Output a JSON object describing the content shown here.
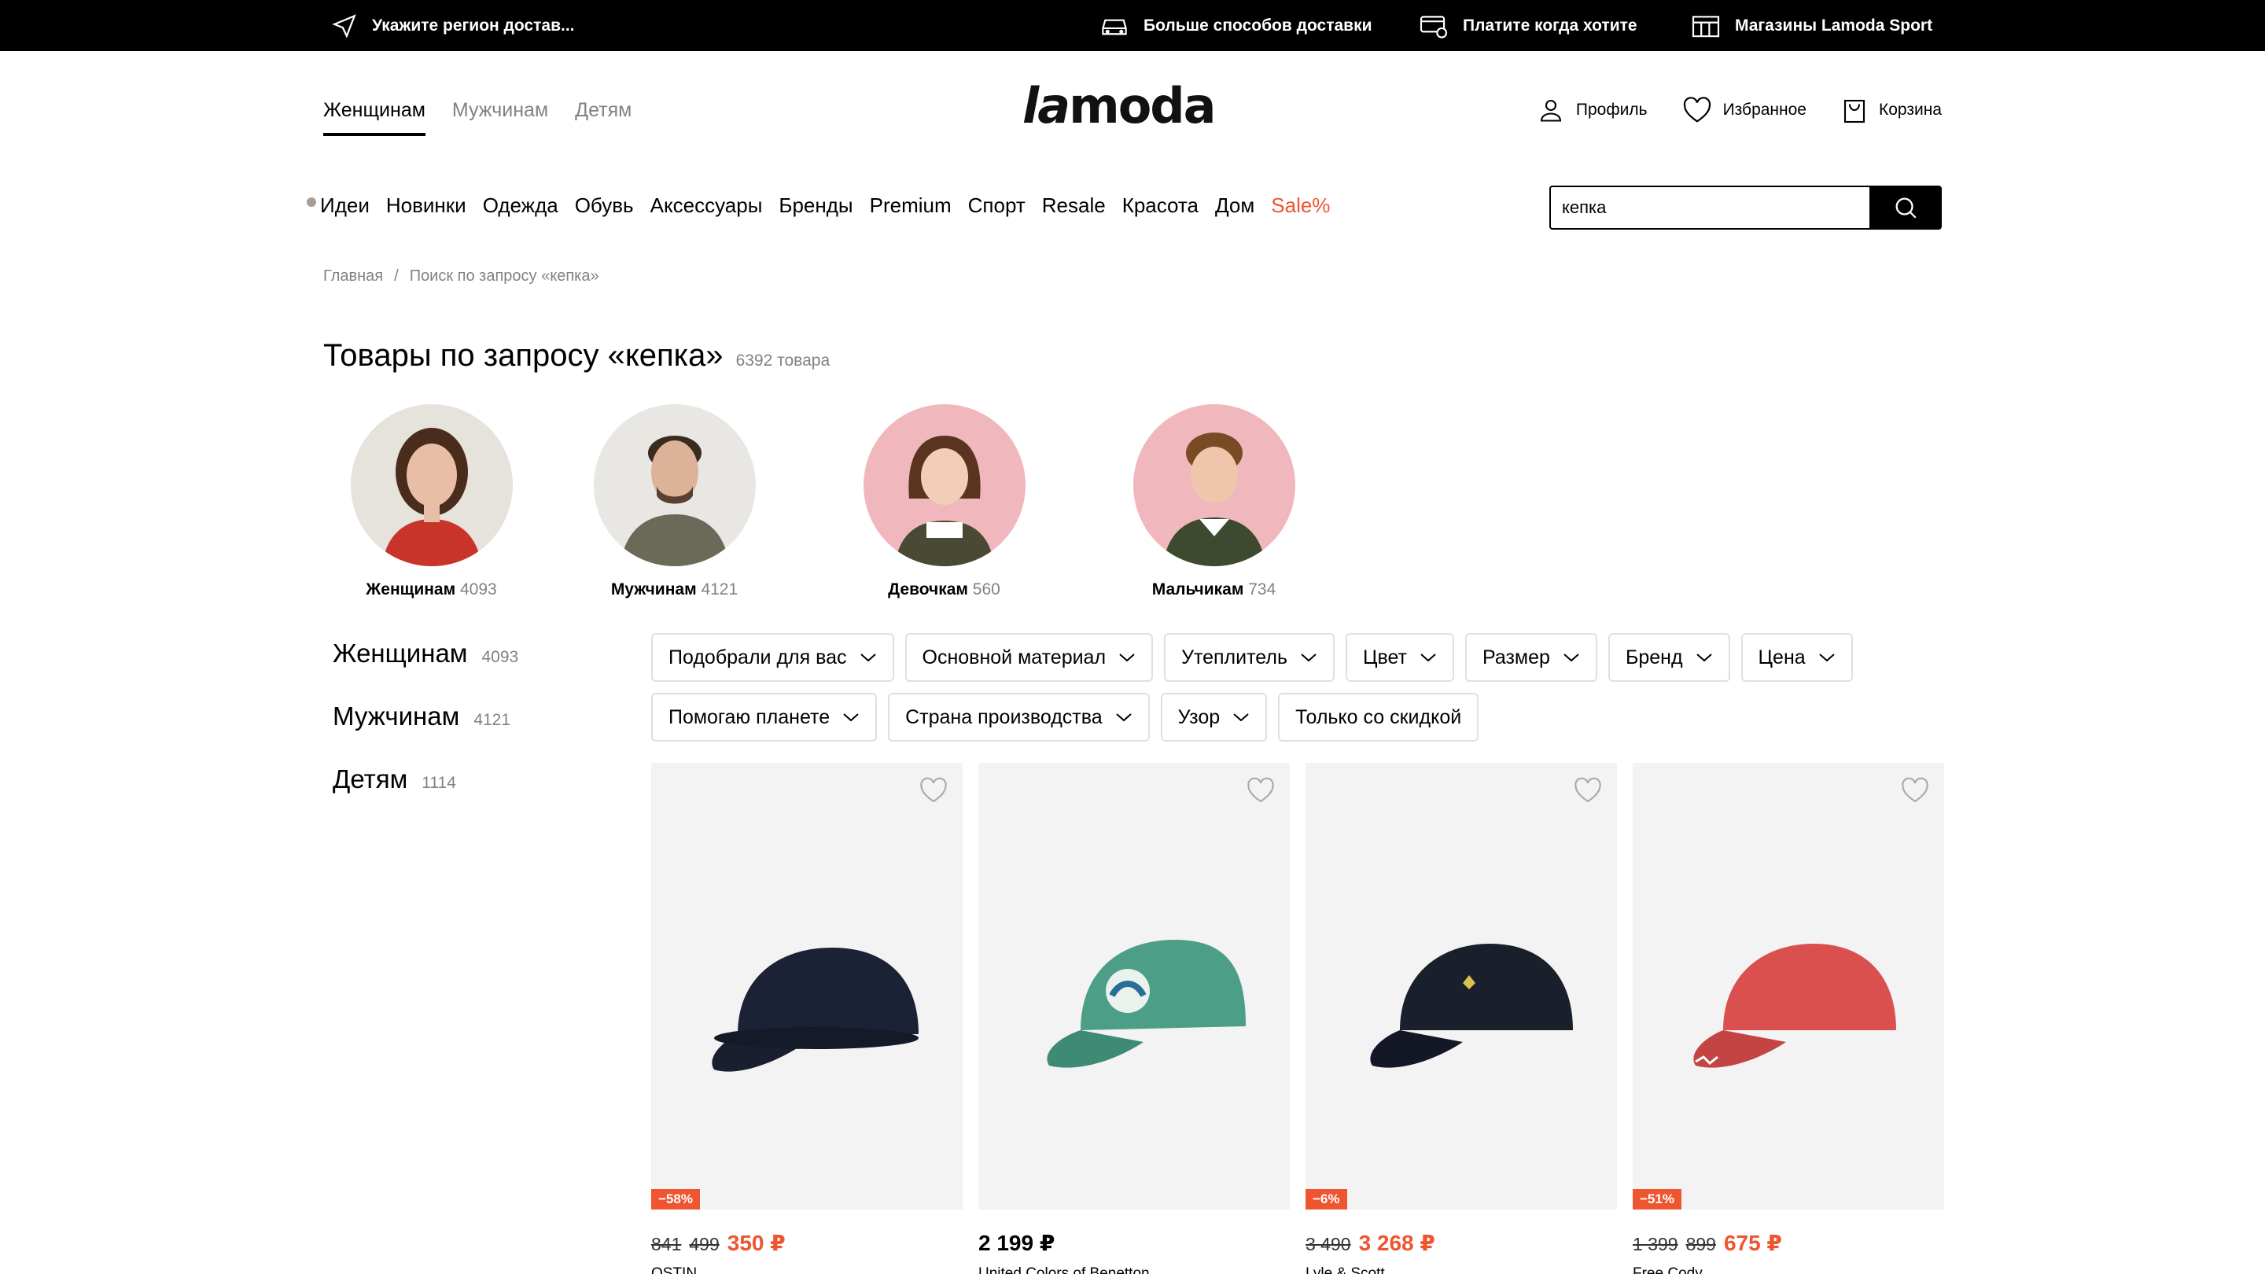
{
  "topbar": {
    "region": "Укажите регион достав...",
    "delivery": "Больше способов доставки",
    "pay": "Платите когда хотите",
    "stores": "Магазины Lamoda Sport"
  },
  "header": {
    "gender_tabs": [
      "Женщинам",
      "Мужчинам",
      "Детям"
    ],
    "logo": "lamoda",
    "profile": "Профиль",
    "favorites": "Избранное",
    "cart": "Корзина"
  },
  "nav": [
    "Идеи",
    "Новинки",
    "Одежда",
    "Обувь",
    "Аксессуары",
    "Бренды",
    "Premium",
    "Спорт",
    "Resale",
    "Красота",
    "Дом",
    "Sale%"
  ],
  "search": {
    "value": "кепка"
  },
  "breadcrumb": {
    "home": "Главная",
    "sep": "/",
    "current": "Поиск по запросу «кепка»"
  },
  "title": {
    "text": "Товары по запросу «кепка»",
    "count": "6392 товара"
  },
  "circles": [
    {
      "label": "Женщинам",
      "count": "4093",
      "bg": "#e6e2dc",
      "shirt": "#c9342a",
      "hair": "#4a2c1c"
    },
    {
      "label": "Мужчинам",
      "count": "4121",
      "bg": "#e9e7e3",
      "shirt": "#6b6a58",
      "hair": "#3a2b1f"
    },
    {
      "label": "Девочкам",
      "count": "560",
      "bg": "#f0b7bd",
      "shirt": "#4a4a34",
      "hair": "#5a3420"
    },
    {
      "label": "Мальчикам",
      "count": "734",
      "bg": "#f0b7bd",
      "shirt": "#3d4a30",
      "hair": "#7a4a25"
    }
  ],
  "side": [
    {
      "label": "Женщинам",
      "count": "4093"
    },
    {
      "label": "Мужчинам",
      "count": "4121"
    },
    {
      "label": "Детям",
      "count": "1114"
    }
  ],
  "filters": [
    "Подобрали для вас",
    "Основной материал",
    "Утеплитель",
    "Цвет",
    "Размер",
    "Бренд",
    "Цена",
    "Помогаю планете",
    "Страна производства",
    "Узор"
  ],
  "filter_toggle": "Только со скидкой",
  "products": [
    {
      "badge": "−58%",
      "old1": "841",
      "old2": "499",
      "price": "350 ₽",
      "brand": "OSTIN",
      "cap": "#1c2236",
      "discount": true
    },
    {
      "badge": "",
      "old1": "",
      "old2": "",
      "price": "2 199 ₽",
      "brand": "United Colors of Benetton",
      "cap": "#4d9e86",
      "discount": false
    },
    {
      "badge": "−6%",
      "old1": "3 490",
      "old2": "",
      "price": "3 268 ₽",
      "brand": "Lyle & Scott",
      "cap": "#1a1f2c",
      "discount": true
    },
    {
      "badge": "−51%",
      "old1": "1 399",
      "old2": "899",
      "price": "675 ₽",
      "brand": "Free Cody",
      "cap": "#d9504f",
      "discount": true
    }
  ],
  "colors": {
    "accent": "#ee5530",
    "muted": "#828282"
  }
}
